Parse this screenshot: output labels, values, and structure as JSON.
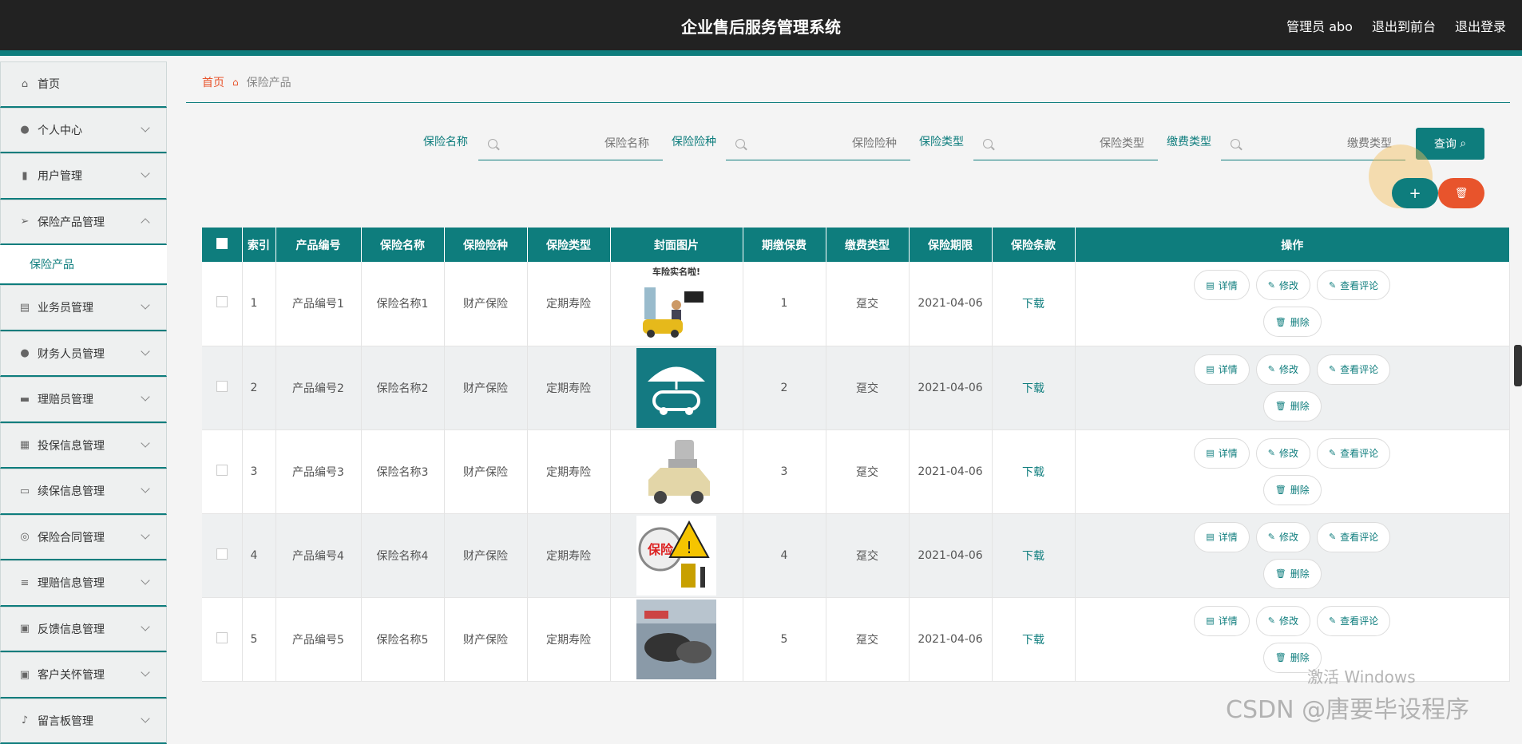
{
  "header": {
    "title": "企业售后服务管理系统",
    "user": "管理员 abo",
    "back_front": "退出到前台",
    "logout": "退出登录"
  },
  "sidebar": {
    "items": [
      {
        "label": "首页",
        "icon": "home-icon"
      },
      {
        "label": "个人中心",
        "icon": "user-icon"
      },
      {
        "label": "用户管理",
        "icon": "chart-icon"
      },
      {
        "label": "保险产品管理",
        "icon": "send-icon"
      },
      {
        "label": "业务员管理",
        "icon": "trend-icon"
      },
      {
        "label": "财务人员管理",
        "icon": "user-icon"
      },
      {
        "label": "理赔员管理",
        "icon": "briefcase-icon"
      },
      {
        "label": "投保信息管理",
        "icon": "grid-icon"
      },
      {
        "label": "续保信息管理",
        "icon": "chat-icon"
      },
      {
        "label": "保险合同管理",
        "icon": "compass-icon"
      },
      {
        "label": "理赔信息管理",
        "icon": "list-icon"
      },
      {
        "label": "反馈信息管理",
        "icon": "clipboard-icon"
      },
      {
        "label": "客户关怀管理",
        "icon": "check-clipboard-icon"
      },
      {
        "label": "留言板管理",
        "icon": "mic-icon"
      }
    ],
    "sub_item": "保险产品"
  },
  "breadcrumb": {
    "home": "首页",
    "current": "保险产品"
  },
  "search": {
    "fields": [
      {
        "label": "保险名称",
        "placeholder": "保险名称"
      },
      {
        "label": "保险险种",
        "placeholder": "保险险种"
      },
      {
        "label": "保险类型",
        "placeholder": "保险类型"
      },
      {
        "label": "缴费类型",
        "placeholder": "缴费类型"
      }
    ],
    "query_label": "查询"
  },
  "table": {
    "headers": [
      "索引",
      "产品编号",
      "保险名称",
      "保险险种",
      "保险类型",
      "封面图片",
      "期缴保费",
      "缴费类型",
      "保险期限",
      "保险条款",
      "操作"
    ],
    "rows": [
      {
        "index": "1",
        "code": "产品编号1",
        "name": "保险名称1",
        "kind": "财产保险",
        "type": "定期寿险",
        "cover_text": "车险实名啦!",
        "premium": "1",
        "pay_type": "趸交",
        "term": "2021-04-06",
        "clause": "下载"
      },
      {
        "index": "2",
        "code": "产品编号2",
        "name": "保险名称2",
        "kind": "财产保险",
        "type": "定期寿险",
        "cover_text": "",
        "premium": "2",
        "pay_type": "趸交",
        "term": "2021-04-06",
        "clause": "下载"
      },
      {
        "index": "3",
        "code": "产品编号3",
        "name": "保险名称3",
        "kind": "财产保险",
        "type": "定期寿险",
        "cover_text": "",
        "premium": "3",
        "pay_type": "趸交",
        "term": "2021-04-06",
        "clause": "下载"
      },
      {
        "index": "4",
        "code": "产品编号4",
        "name": "保险名称4",
        "kind": "财产保险",
        "type": "定期寿险",
        "cover_text": "保险",
        "premium": "4",
        "pay_type": "趸交",
        "term": "2021-04-06",
        "clause": "下载"
      },
      {
        "index": "5",
        "code": "产品编号5",
        "name": "保险名称5",
        "kind": "财产保险",
        "type": "定期寿险",
        "cover_text": "",
        "premium": "5",
        "pay_type": "趸交",
        "term": "2021-04-06",
        "clause": "下载"
      }
    ],
    "ops": {
      "detail": "详情",
      "edit": "修改",
      "review": "查看评论",
      "delete": "删除"
    }
  },
  "overlay": {
    "activate": "激活 Windows",
    "csdn": "CSDN @唐要毕设程序"
  },
  "colors": {
    "accent": "#0e7d7d",
    "danger": "#e8542c",
    "topbar": "#222222"
  }
}
